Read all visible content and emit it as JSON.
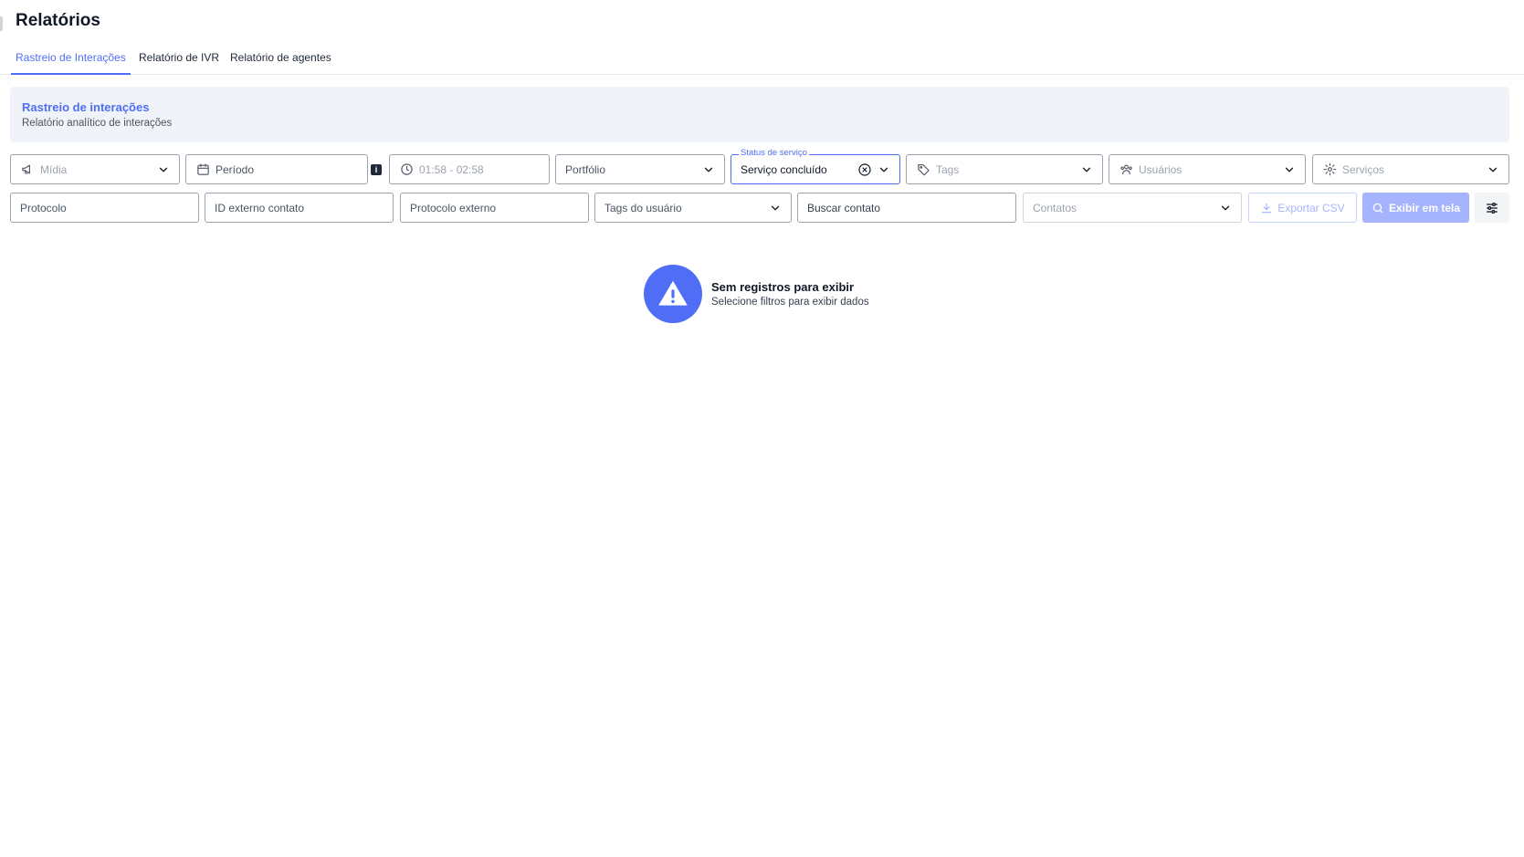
{
  "page": {
    "title": "Relatórios"
  },
  "tabs": [
    {
      "label": "Rastreio de Interações",
      "active": true
    },
    {
      "label": "Relatório de IVR",
      "active": false
    },
    {
      "label": "Relatório de agentes",
      "active": false
    }
  ],
  "banner": {
    "title": "Rastreio de interações",
    "subtitle": "Relatório analítico de interações"
  },
  "filters": {
    "midia": {
      "placeholder": "Mídia",
      "icon": "megaphone-icon"
    },
    "periodo": {
      "placeholder": "Período",
      "icon": "calendar-icon",
      "info": "i"
    },
    "hora": {
      "value": "01:58 - 02:58",
      "icon": "clock-icon"
    },
    "portfolio": {
      "placeholder": "Portfólio"
    },
    "status_servico": {
      "label": "Status de serviço",
      "value": "Serviço concluído"
    },
    "tags": {
      "placeholder": "Tags",
      "icon": "tag-icon"
    },
    "usuarios": {
      "placeholder": "Usuários",
      "icon": "users-icon"
    },
    "servicos": {
      "placeholder": "Serviços",
      "icon": "gear-icon"
    },
    "protocolo": {
      "placeholder": "Protocolo"
    },
    "id_externo": {
      "placeholder": "ID externo contato"
    },
    "protocolo_externo": {
      "placeholder": "Protocolo externo"
    },
    "tags_usuario": {
      "placeholder": "Tags do usuário"
    },
    "buscar_contato": {
      "placeholder": "Buscar contato"
    },
    "contatos": {
      "placeholder": "Contatos"
    }
  },
  "actions": {
    "export_label": "Exportar CSV",
    "show_label": "Exibir em tela"
  },
  "empty_state": {
    "title": "Sem registros para exibir",
    "subtitle": "Selecione filtros para exibir dados"
  },
  "colors": {
    "accent": "#4f6ef5",
    "banner_bg": "#f0f3f8",
    "disabled_accent": "#a5b4fc"
  }
}
